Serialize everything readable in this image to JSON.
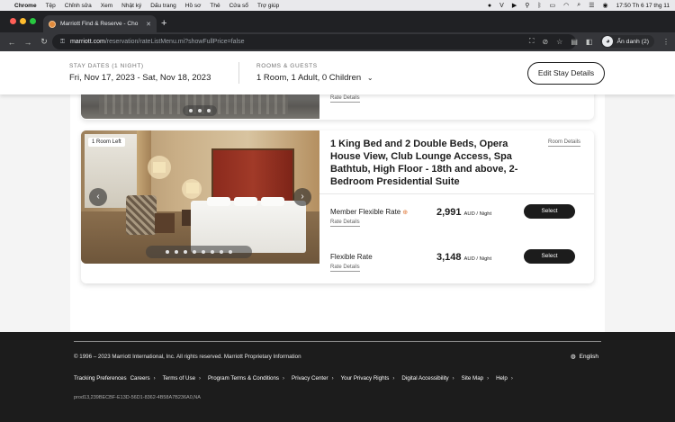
{
  "menubar": {
    "app_name": "Chrome",
    "items": [
      "Tệp",
      "Chỉnh sửa",
      "Xem",
      "Nhật ký",
      "Dấu trang",
      "Hồ sơ",
      "Thẻ",
      "Cửa sổ",
      "Trợ giúp"
    ],
    "clock": "17:50 Th 6 17 thg 11"
  },
  "browser": {
    "tab_title": "Marriott Find & Reserve - Cho",
    "url_host": "marriott.com",
    "url_path": "/reservation/rateListMenu.mi?showFullPrice=false",
    "profile_label": "Ẩn danh (2)"
  },
  "stay": {
    "dates_label": "STAY DATES (1 NIGHT)",
    "dates_value": "Fri, Nov 17, 2023 - Sat, Nov 18, 2023",
    "guests_label": "ROOMS & GUESTS",
    "guests_value": "1 Room, 1 Adult, 0 Children",
    "edit_button": "Edit Stay Details"
  },
  "card1": {
    "rate_details": "Rate Details"
  },
  "room": {
    "badge": "1 Room Left",
    "title": "1 King Bed and 2 Double Beds, Opera House View, Club Lounge Access, Spa Bathtub, High Floor - 18th and above, 2-Bedroom Presidential Suite",
    "details_link": "Room Details",
    "photo_count": 8,
    "rates": [
      {
        "name": "Member Flexible Rate",
        "details": "Rate Details",
        "price": "2,991",
        "unit": "AUD / Night",
        "button": "Select"
      },
      {
        "name": "Flexible Rate",
        "details": "Rate Details",
        "price": "3,148",
        "unit": "AUD / Night",
        "button": "Select"
      }
    ]
  },
  "footer": {
    "copyright": "© 1996 – 2023 Marriott International, Inc. All rights reserved. Marriott Proprietary Information",
    "language": "English",
    "links": [
      "Tracking Preferences",
      "Careers",
      "Terms of Use",
      "Program Terms & Conditions",
      "Privacy Center",
      "Your Privacy Rights",
      "Digital Accessibility",
      "Site Map",
      "Help"
    ],
    "prod_id": "prod13,239BECBF-E13D-56D1-8362-4B58A7B236A0,NA"
  }
}
